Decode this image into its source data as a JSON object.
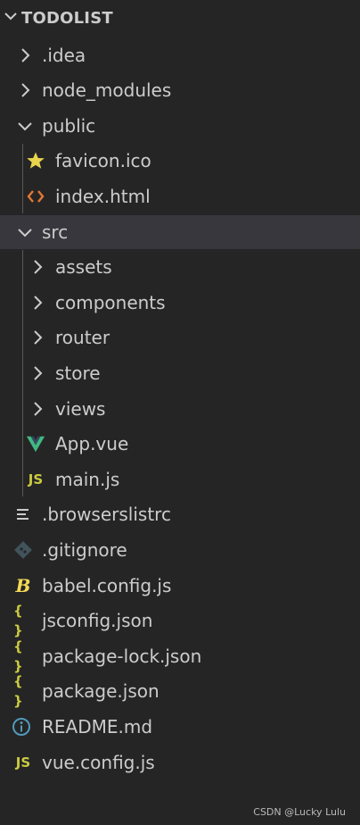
{
  "explorer": {
    "root_label": "TODOLIST",
    "items": [
      {
        "label": ".idea"
      },
      {
        "label": "node_modules"
      },
      {
        "label": "public"
      },
      {
        "label": "favicon.ico"
      },
      {
        "label": "index.html"
      },
      {
        "label": "src"
      },
      {
        "label": "assets"
      },
      {
        "label": "components"
      },
      {
        "label": "router"
      },
      {
        "label": "store"
      },
      {
        "label": "views"
      },
      {
        "label": "App.vue"
      },
      {
        "label": "main.js"
      },
      {
        "label": ".browserslistrc"
      },
      {
        "label": ".gitignore"
      },
      {
        "label": "babel.config.js"
      },
      {
        "label": "jsconfig.json"
      },
      {
        "label": "package-lock.json"
      },
      {
        "label": "package.json"
      },
      {
        "label": "README.md"
      },
      {
        "label": "vue.config.js"
      }
    ],
    "icons": {
      "js_text": "JS",
      "json_text": "{ }",
      "babel_text": "B"
    }
  },
  "colors": {
    "background": "#252526",
    "selected_row": "#37373d",
    "text": "#cccccc",
    "favicon_star": "#e8d44d",
    "html_icon": "#e37933",
    "vue_green": "#41b883",
    "js_yellow": "#cbcb41",
    "json_yellow": "#cbcb41",
    "git_icon": "#41535b",
    "info_icon": "#519aba"
  },
  "watermark": "CSDN @Lucky Lulu"
}
